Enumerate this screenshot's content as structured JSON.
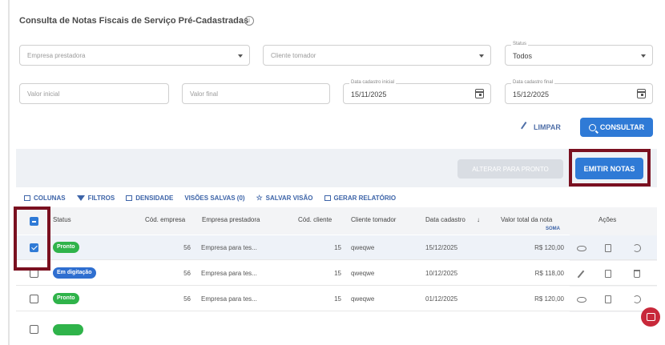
{
  "page": {
    "title": "Consulta de Notas Fiscais de Serviço Pré-Cadastradas",
    "info_icon": "info-icon"
  },
  "filters": {
    "empresa": {
      "placeholder": "Empresa prestadora"
    },
    "cliente": {
      "placeholder": "Cliente tomador"
    },
    "status": {
      "label": "Status",
      "value": "Todos"
    },
    "valor_inicial": {
      "placeholder": "Valor inicial"
    },
    "valor_final": {
      "placeholder": "Valor final"
    },
    "data_inicial": {
      "label": "Data cadastro inicial",
      "value": "15/11/2025"
    },
    "data_final": {
      "label": "Data cadastro final",
      "value": "15/12/2025"
    }
  },
  "actions": {
    "limpar": "LIMPAR",
    "consultar": "CONSULTAR",
    "alterar": "ALTERAR PARA PRONTO",
    "emitir": "EMITIR NOTAS"
  },
  "toolbar": {
    "colunas": "COLUNAS",
    "filtros": "FILTROS",
    "densidade": "DENSIDADE",
    "visoes": "VISÕES SALVAS (0)",
    "salvar": "SALVAR VISÃO",
    "relatorio": "GERAR RELATÓRIO"
  },
  "table": {
    "headers": {
      "status": "Status",
      "cod_empresa": "Cód. empresa",
      "empresa": "Empresa prestadora",
      "cod_cliente": "Cód. cliente",
      "cliente": "Cliente tomador",
      "data": "Data cadastro",
      "sort_indicator": "↓",
      "valor": "Valor total da nota",
      "valor_sub": "SOMA",
      "acoes": "Ações"
    },
    "rows": [
      {
        "status": "Pronto",
        "cod_empresa": "56",
        "empresa": "Empresa para tes...",
        "cod_cliente": "15",
        "cliente": "qweqwe",
        "data": "15/12/2025",
        "valor": "R$ 120,00"
      },
      {
        "status": "Em digitação",
        "cod_empresa": "56",
        "empresa": "Empresa para tes...",
        "cod_cliente": "15",
        "cliente": "qweqwe",
        "data": "10/12/2025",
        "valor": "R$ 118,00"
      },
      {
        "status": "Pronto",
        "cod_empresa": "56",
        "empresa": "Empresa para tes...",
        "cod_cliente": "15",
        "cliente": "qweqwe",
        "data": "01/12/2025",
        "valor": "R$ 120,00"
      }
    ]
  },
  "colors": {
    "primary": "#2f7ad6",
    "highlight": "#7a1020",
    "status_pronto": "#2fb34a",
    "status_digitacao": "#2f6fd0"
  }
}
